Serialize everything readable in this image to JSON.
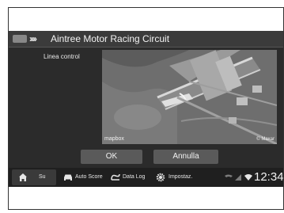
{
  "window": {
    "title": "Aintree Motor Racing Circuit"
  },
  "screen": {
    "line_label": "Linea control"
  },
  "map": {
    "attribution_left": "mapbox",
    "attribution_right": "© Maxar"
  },
  "buttons": {
    "ok": "OK",
    "cancel": "Annulla"
  },
  "bottom_bar": {
    "home": "Su",
    "items": [
      "Auto Score",
      "Data Log",
      "Impostaz."
    ],
    "clock": "12:34"
  },
  "colors": {
    "screen_bg": "#2b2b2b",
    "button_bg": "#5a5a5a",
    "bottombar_bg": "#1f1f1f",
    "text": "#f2f2f2"
  }
}
